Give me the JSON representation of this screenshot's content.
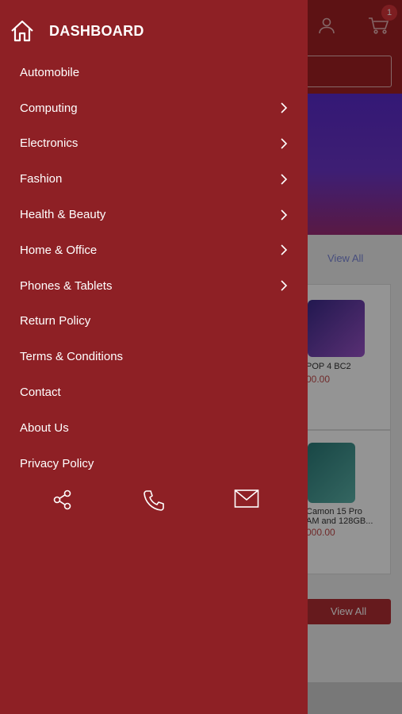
{
  "drawer": {
    "title": "DASHBOARD",
    "items": [
      {
        "label": "Automobile",
        "has_submenu": false
      },
      {
        "label": "Computing",
        "has_submenu": true
      },
      {
        "label": "Electronics",
        "has_submenu": true
      },
      {
        "label": "Fashion",
        "has_submenu": true
      },
      {
        "label": "Health & Beauty",
        "has_submenu": true
      },
      {
        "label": "Home & Office",
        "has_submenu": true
      },
      {
        "label": "Phones & Tablets",
        "has_submenu": true
      },
      {
        "label": "Return Policy",
        "has_submenu": false
      },
      {
        "label": "Terms & Conditions",
        "has_submenu": false
      },
      {
        "label": "Contact",
        "has_submenu": false
      },
      {
        "label": "About Us",
        "has_submenu": false
      },
      {
        "label": "Privacy Policy",
        "has_submenu": false
      }
    ],
    "actions": [
      "share-icon",
      "phone-icon",
      "mail-icon"
    ]
  },
  "background": {
    "cart_badge": "1",
    "view_all_top": "View All",
    "products": [
      {
        "name": "POP 4 BC2",
        "price": "00.00"
      },
      {
        "name_line1": "Camon 15 Pro",
        "name_line2": "AM and 128GB...",
        "price": "000.00"
      }
    ],
    "view_all_button": "View All"
  },
  "colors": {
    "drawer": "#8e2025",
    "topbar": "#a11f24",
    "banner_start": "#5a2acb",
    "banner_end": "#9a2c75"
  }
}
